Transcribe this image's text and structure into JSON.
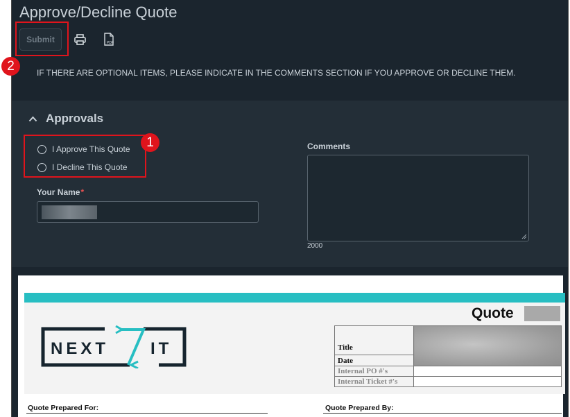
{
  "header": {
    "title": "Approve/Decline Quote",
    "submit_label": "Submit",
    "print_icon": "printer-icon",
    "pdf_icon": "pdf-icon",
    "pdf_icon_text": "PDF",
    "notice": "IF THERE ARE OPTIONAL ITEMS, PLEASE INDICATE IN THE COMMENTS SECTION IF YOU APPROVE OR DECLINE THEM."
  },
  "approvals": {
    "section_title": "Approvals",
    "collapse_icon": "chevron-up-icon",
    "options": [
      {
        "label": "I Approve This Quote",
        "selected": false
      },
      {
        "label": "I Decline This Quote",
        "selected": false
      }
    ],
    "name_label": "Your Name",
    "required_marker": "*",
    "comments_label": "Comments",
    "comments_value": "",
    "char_limit": "2000"
  },
  "quote": {
    "title": "Quote",
    "logo_text_left": "NEXT",
    "logo_text_right": "IT",
    "table": {
      "title_label": "Title",
      "date_label": "Date",
      "po_label": "Internal PO #'s",
      "ticket_label": "Internal Ticket #'s"
    },
    "prepared_for_label": "Quote Prepared For:",
    "prepared_by_label": "Quote Prepared By:"
  },
  "annotations": {
    "badge_1": "1",
    "badge_2": "2"
  },
  "colors": {
    "header_bg": "#1b252e",
    "panel_bg": "#232e37",
    "text": "#c9d1d8",
    "accent_teal": "#27bec2",
    "annotation_red": "#e0141c",
    "required_red": "#e05050"
  }
}
